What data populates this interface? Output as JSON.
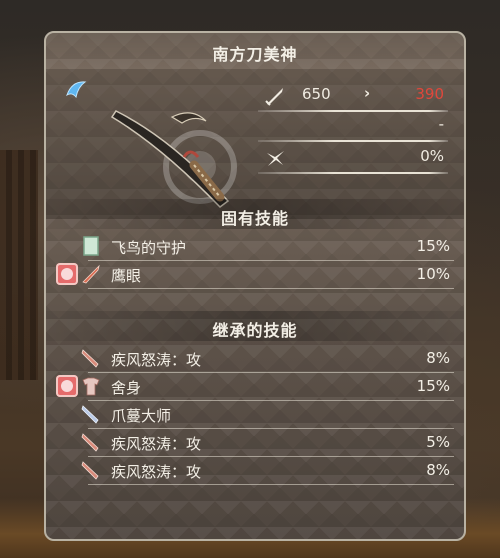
{
  "weapon": {
    "name": "南方刀美神",
    "attack_base": "650",
    "attack_arrow": "›",
    "attack_new": "390",
    "element_value": "-",
    "affinity_value": "0%"
  },
  "icons": {
    "rarity": "blue-talisman-icon",
    "weapon": "longsword-icon",
    "attack": "sword-attack-icon",
    "affinity": "affinity-slash-icon",
    "inherent_skill": "shield-skill-icon",
    "hawkeye": "red-decoration-icon",
    "bow_skill": "sword-skill-icon",
    "anger": "claw-blade-icon",
    "sacrifice": "armor-skill-icon",
    "claw_master": "double-blade-icon"
  },
  "colors": {
    "attack_reduced": "#e0473b",
    "panel_border": "#b9b2a3",
    "decoration": "#e56b6b"
  },
  "inherent": {
    "heading": "固有技能",
    "skills": [
      {
        "name": "飞鸟的守护",
        "pct": "15%"
      },
      {
        "name": "鹰眼",
        "pct": "10%"
      }
    ]
  },
  "inherited": {
    "heading": "继承的技能",
    "skills": [
      {
        "name": "疾风怒涛：攻",
        "pct": "8%"
      },
      {
        "name": "舍身",
        "pct": "15%"
      },
      {
        "name": "爪蔓大师",
        "pct": ""
      },
      {
        "name": "疾风怒涛：攻",
        "pct": "5%"
      },
      {
        "name": "疾风怒涛：攻",
        "pct": "8%"
      }
    ]
  }
}
